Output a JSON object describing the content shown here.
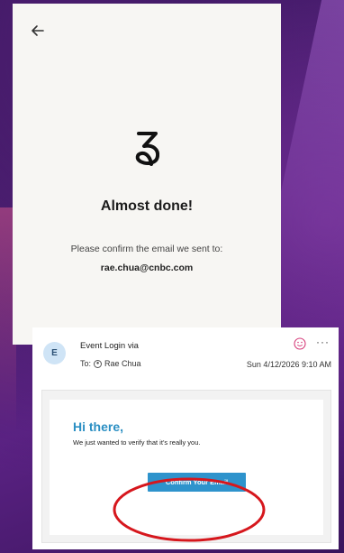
{
  "app": {
    "title": "Almost done!",
    "message": "Please confirm the email we sent to:",
    "email": "rae.chua@cnbc.com",
    "icons": {
      "back": "arrow-left-icon",
      "logo": "brand-logo"
    }
  },
  "email": {
    "avatar_initial": "E",
    "sender": "Event Login via",
    "to_label": "To:",
    "recipient": "Rae Chua",
    "date": "Sun 4/12/2026 9:10 AM",
    "more": "···",
    "icons": {
      "reaction": "smiley-icon",
      "more": "more-icon",
      "recipient": "person-icon"
    },
    "body": {
      "greeting": "Hi there,",
      "text": "We just wanted to verify that it’s really you.",
      "button": "Confirm Your Email"
    }
  },
  "colors": {
    "accent_blue": "#2e93cc",
    "greeting_blue": "#2b8fc3",
    "highlight_red": "#d6171d",
    "reaction_pink": "#d63c7a"
  }
}
